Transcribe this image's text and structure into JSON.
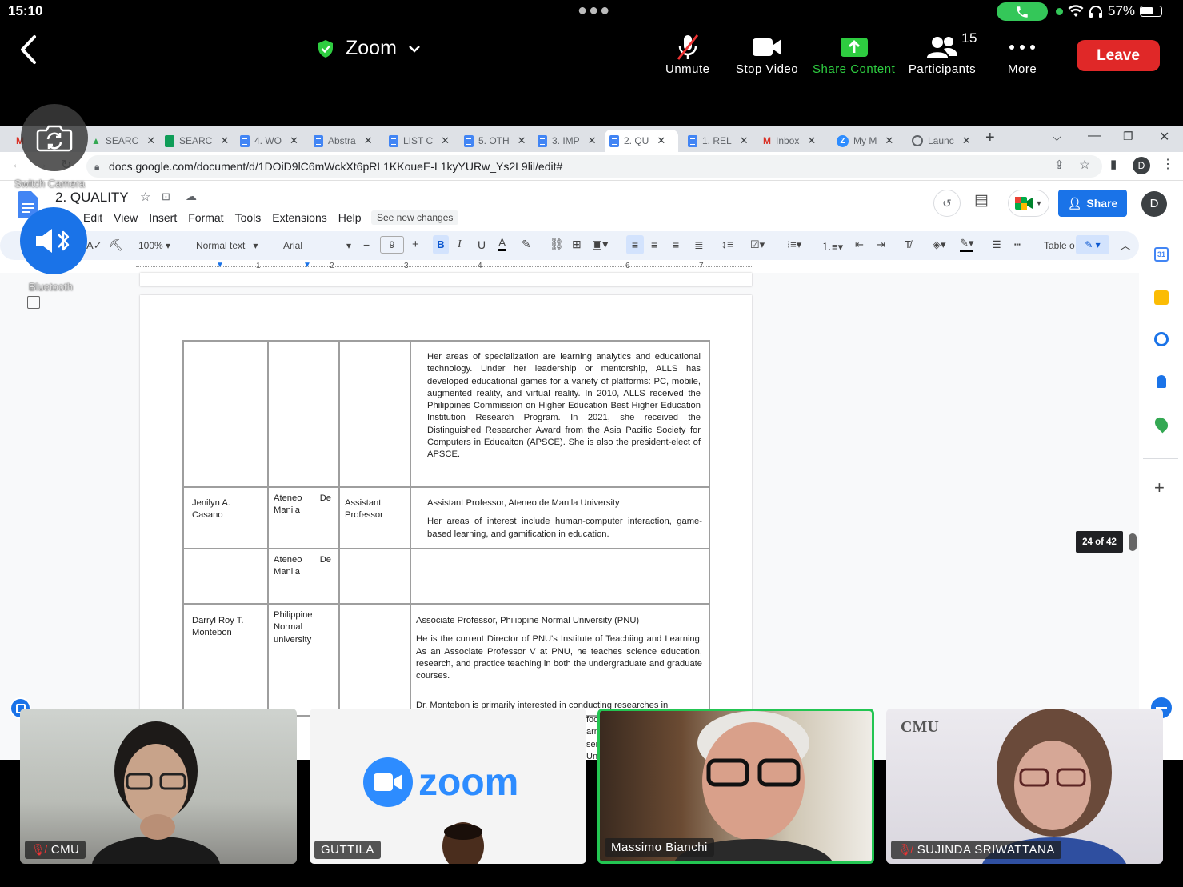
{
  "status_bar": {
    "time": "15:10",
    "battery": "57%"
  },
  "zoom": {
    "title": "Zoom",
    "buttons": {
      "unmute": "Unmute",
      "stop_video": "Stop Video",
      "share_content": "Share Content",
      "participants": "Participants",
      "participants_count": "15",
      "more": "More"
    },
    "leave": "Leave",
    "switch_camera": "Switch Camera",
    "bluetooth": "Bluetooth"
  },
  "browser": {
    "tabs": [
      {
        "label": "M"
      },
      {
        "label": "SEARC"
      },
      {
        "label": "SEARC"
      },
      {
        "label": "4. WO"
      },
      {
        "label": "Abstra"
      },
      {
        "label": "LIST C"
      },
      {
        "label": "5. OTH"
      },
      {
        "label": "3. IMP"
      },
      {
        "label": "2. QU"
      },
      {
        "label": "1. REL"
      },
      {
        "label": "Inbox"
      },
      {
        "label": "My M"
      },
      {
        "label": "Launc"
      }
    ],
    "url": "docs.google.com/document/d/1DOiD9lC6mWckXt6pRL1KKoueE-L1kyYURw_Ys2L9lil/edit#"
  },
  "doc": {
    "title": "2. QUALITY",
    "menu": [
      "Edit",
      "View",
      "Insert",
      "Format",
      "Tools",
      "Extensions",
      "Help"
    ],
    "see_changes": "See new changes",
    "share": "Share",
    "avatar": "D",
    "toolbar": {
      "zoom": "100%",
      "style": "Normal text",
      "font": "Arial",
      "size": "9",
      "table_opt": "Table o"
    },
    "ruler": [
      "1",
      "2",
      "3",
      "4",
      "5",
      "6",
      "7"
    ],
    "pager": "24 of 42",
    "rows": [
      {
        "name": "",
        "inst": "",
        "pos": "",
        "desc": "Her areas of specialization are learning analytics and educational technology. Under her leadership or mentorship, ALLS has developed educational games for a variety of platforms: PC, mobile, augmented reality, and virtual reality. In 2010, ALLS received the Philippines Commission on Higher Education Best Higher Education Institution Research Program. In 2021, she received the Distinguished Researcher Award from the Asia Pacific Society for Computers in Educaiton (APSCE). She is also the president-elect of APSCE."
      },
      {
        "name": "Jenilyn A. Casano",
        "inst": "Ateneo De Manila",
        "pos": "Assistant Professor",
        "desc1": "Assistant Professor, Ateneo de Manila University",
        "desc2": "Her areas of interest include human-computer interaction, game-based learning, and gamification in education."
      },
      {
        "name": "",
        "inst": "Ateneo De Manila",
        "pos": "",
        "desc": ""
      },
      {
        "name": "Darryl Roy T. Montebon",
        "inst": "Philippine Normal university",
        "pos": "",
        "desc1": "Associate Professor, Philippine Normal University (PNU)",
        "desc2": "He is the current Director of PNU's Institute of Teachiing and Learning. As an Associate Professor V at PNU, he teaches science education, research, and practice teaching in both the undergraduate and graduate courses.",
        "desc3": "Dr. Montebon is primarily interested in conducting researches in"
      }
    ],
    "peek": [
      "foc",
      "arni",
      "ser",
      "Un"
    ]
  },
  "participants": [
    {
      "name": "CMU",
      "muted": true
    },
    {
      "name": "GUTTILA",
      "muted": false,
      "logo": "zoom"
    },
    {
      "name": "Massimo Bianchi",
      "muted": false,
      "active": true
    },
    {
      "name": "SUJINDA SRIWATTANA",
      "muted": true,
      "logo": "CMU"
    }
  ],
  "colors": {
    "zoom_green": "#34c759",
    "leave_red": "#e02828",
    "docs_blue": "#1a73e8",
    "active_speaker": "#23c552"
  }
}
